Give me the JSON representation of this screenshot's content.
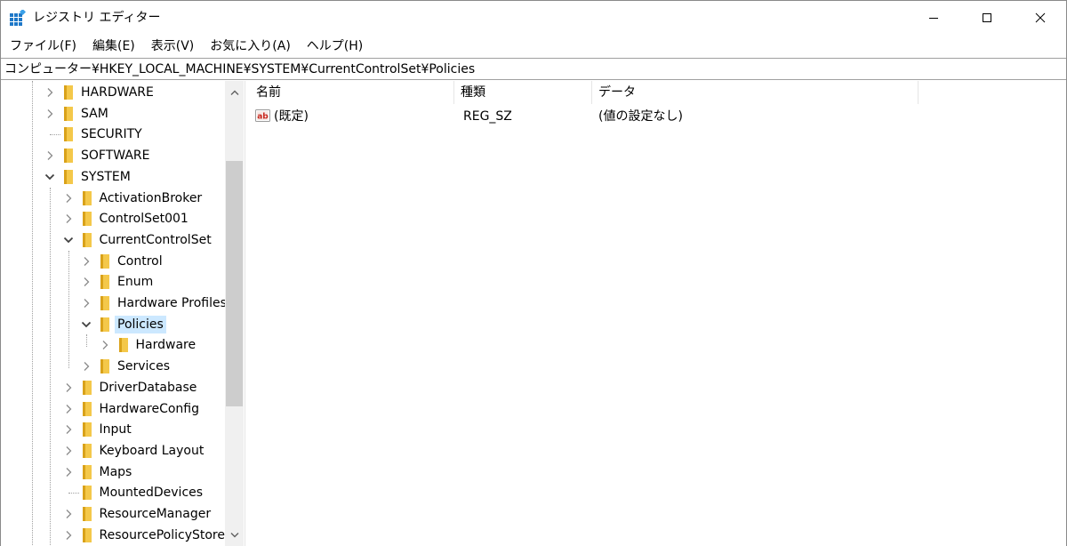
{
  "window": {
    "title": "レジストリ エディター"
  },
  "menu": [
    "ファイル(F)",
    "編集(E)",
    "表示(V)",
    "お気に入り(A)",
    "ヘルプ(H)"
  ],
  "address": {
    "path": "コンピューター¥HKEY_LOCAL_MACHINE¥SYSTEM¥CurrentControlSet¥Policies"
  },
  "tree": {
    "items": [
      {
        "label": "HARDWARE",
        "level": 0,
        "expander": "collapsed"
      },
      {
        "label": "SAM",
        "level": 0,
        "expander": "collapsed"
      },
      {
        "label": "SECURITY",
        "level": 0,
        "expander": "none"
      },
      {
        "label": "SOFTWARE",
        "level": 0,
        "expander": "collapsed"
      },
      {
        "label": "SYSTEM",
        "level": 0,
        "expander": "expanded"
      },
      {
        "label": "ActivationBroker",
        "level": 1,
        "expander": "collapsed"
      },
      {
        "label": "ControlSet001",
        "level": 1,
        "expander": "collapsed"
      },
      {
        "label": "CurrentControlSet",
        "level": 1,
        "expander": "expanded"
      },
      {
        "label": "Control",
        "level": 2,
        "expander": "collapsed"
      },
      {
        "label": "Enum",
        "level": 2,
        "expander": "collapsed"
      },
      {
        "label": "Hardware Profiles",
        "level": 2,
        "expander": "collapsed"
      },
      {
        "label": "Policies",
        "level": 2,
        "expander": "expanded",
        "selected": true
      },
      {
        "label": "Hardware",
        "level": 3,
        "expander": "collapsed"
      },
      {
        "label": "Services",
        "level": 2,
        "expander": "collapsed"
      },
      {
        "label": "DriverDatabase",
        "level": 1,
        "expander": "collapsed"
      },
      {
        "label": "HardwareConfig",
        "level": 1,
        "expander": "collapsed"
      },
      {
        "label": "Input",
        "level": 1,
        "expander": "collapsed"
      },
      {
        "label": "Keyboard Layout",
        "level": 1,
        "expander": "collapsed"
      },
      {
        "label": "Maps",
        "level": 1,
        "expander": "collapsed"
      },
      {
        "label": "MountedDevices",
        "level": 1,
        "expander": "none"
      },
      {
        "label": "ResourceManager",
        "level": 1,
        "expander": "collapsed"
      },
      {
        "label": "ResourcePolicyStore",
        "level": 1,
        "expander": "collapsed"
      }
    ]
  },
  "list": {
    "columns": [
      "名前",
      "種類",
      "データ"
    ],
    "rows": [
      {
        "name": "(既定)",
        "type": "REG_SZ",
        "data": "(値の設定なし)",
        "icon": "ab-string-icon"
      }
    ]
  },
  "colors": {
    "selection": "#cce8ff",
    "folder": "#f4c84a",
    "scroll_thumb": "#cdcdcd",
    "ab_icon_red": "#c8281e"
  }
}
